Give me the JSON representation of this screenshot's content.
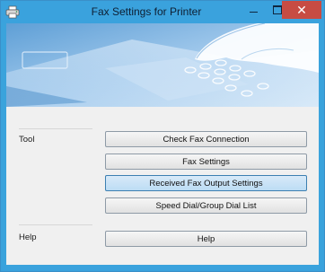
{
  "window": {
    "title": "Fax Settings for Printer",
    "minimize_icon": "minimize-icon",
    "maximize_icon": "maximize-icon",
    "close_icon": "close-icon",
    "app_icon": "printer-icon",
    "close_symbol": "✕"
  },
  "banner": {
    "illustration": "hand-pressing-fax-keypad"
  },
  "tool": {
    "label": "Tool",
    "buttons": [
      {
        "label": "Check Fax Connection"
      },
      {
        "label": "Fax Settings"
      },
      {
        "label": "Received Fax Output Settings"
      },
      {
        "label": "Speed Dial/Group Dial List"
      }
    ]
  },
  "help": {
    "label": "Help",
    "button": {
      "label": "Help"
    }
  },
  "colors": {
    "frame": "#3aa2dd",
    "content_bg": "#f0f0f0",
    "close_button": "#c74c43",
    "focused_button": "#bcdcf4"
  }
}
